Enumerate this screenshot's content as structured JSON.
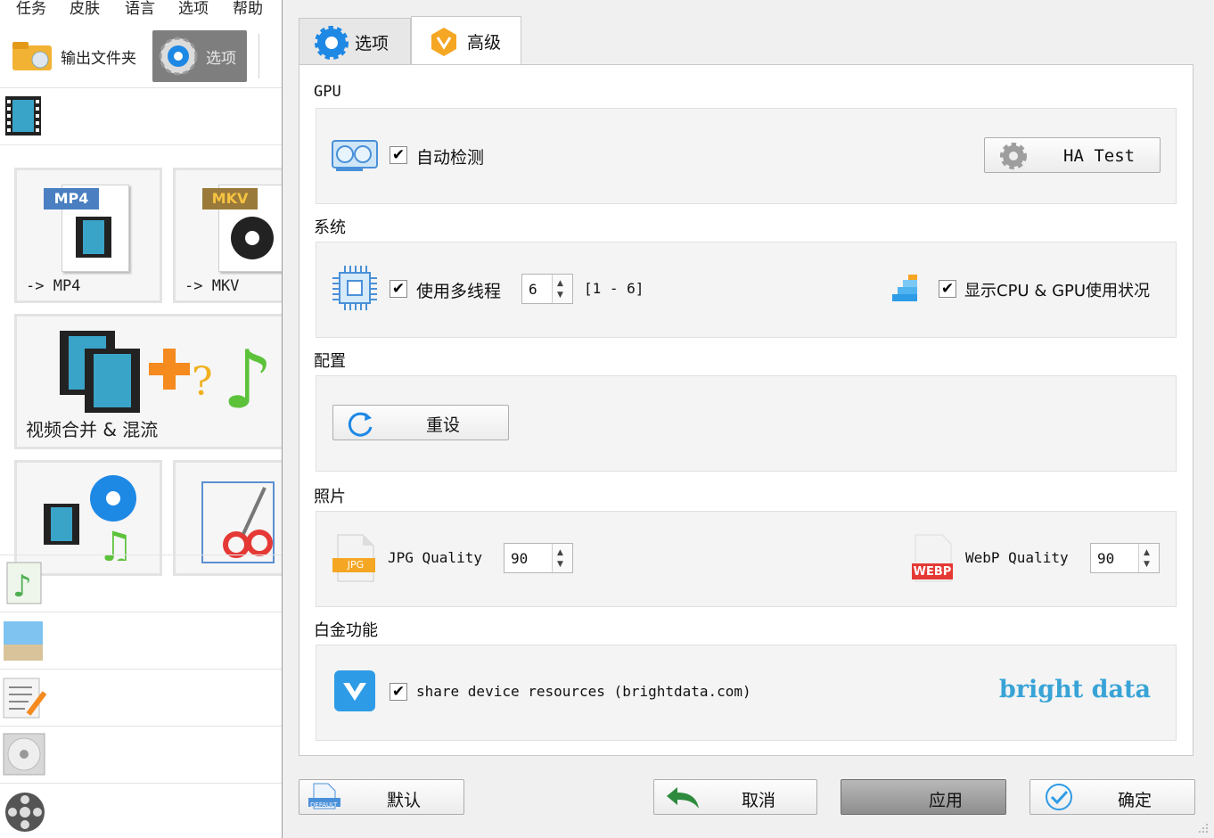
{
  "menu": [
    "任务",
    "皮肤",
    "语言",
    "选项",
    "帮助"
  ],
  "toolbar": {
    "output_folder": "输出文件夹",
    "options": "选项"
  },
  "tiles": {
    "mp4": "-> MP4",
    "mkv": "-> MKV",
    "merge": "视频合并 & 混流",
    "mp4_badge": "MP4",
    "mkv_badge": "MKV"
  },
  "tabs": {
    "options": "选项",
    "advanced": "高级"
  },
  "sections": {
    "gpu": {
      "title": "GPU",
      "auto_detect": "自动检测",
      "auto_detect_checked": true,
      "ha_test": "HA Test"
    },
    "system": {
      "title": "系统",
      "multithread": "使用多线程",
      "multithread_checked": true,
      "threads": "6",
      "range": "[1 - 6]",
      "show_usage": "显示CPU & GPU使用状况",
      "show_usage_checked": true
    },
    "config": {
      "title": "配置",
      "reset": "重设"
    },
    "photo": {
      "title": "照片",
      "jpg_label": "JPG Quality",
      "jpg_value": "90",
      "jpg_badge": "JPG",
      "webp_label": "WebP Quality",
      "webp_value": "90",
      "webp_badge": "WEBP"
    },
    "platinum": {
      "title": "白金功能",
      "share": "share device resources (brightdata.com)",
      "share_checked": true,
      "logo": "bright data"
    }
  },
  "footer": {
    "default": "默认",
    "cancel": "取消",
    "apply": "应用",
    "ok": "确定",
    "default_icon_text": "DEFAULT"
  },
  "colors": {
    "accent": "#38a3d6",
    "gear": "#1e88e5",
    "tab_icon": "#f5a623",
    "webp": "#e53935"
  }
}
